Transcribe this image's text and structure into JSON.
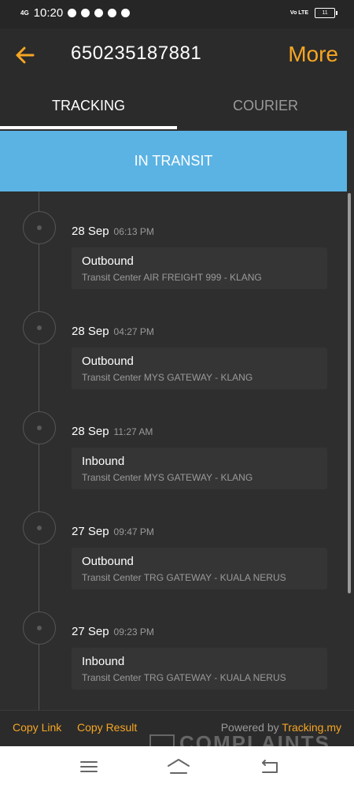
{
  "status_bar": {
    "network": "4G",
    "time": "10:20",
    "volte": "Vo LTE",
    "battery": "11"
  },
  "header": {
    "back_icon": "arrow-left-icon",
    "tracking_number": "650235187881",
    "more_label": "More",
    "accent_color": "#f6a623"
  },
  "tabs": [
    {
      "label": "TRACKING",
      "active": true
    },
    {
      "label": "COURIER",
      "active": false
    }
  ],
  "status_banner": {
    "label": "IN TRANSIT",
    "color": "#5bb3e4"
  },
  "events": [
    {
      "date": "28 Sep",
      "time": "06:13 PM",
      "type": "Outbound",
      "location": "Transit Center AIR FREIGHT 999 - KLANG"
    },
    {
      "date": "28 Sep",
      "time": "04:27 PM",
      "type": "Outbound",
      "location": "Transit Center MYS GATEWAY - KLANG"
    },
    {
      "date": "28 Sep",
      "time": "11:27 AM",
      "type": "Inbound",
      "location": "Transit Center MYS GATEWAY - KLANG"
    },
    {
      "date": "27 Sep",
      "time": "09:47 PM",
      "type": "Outbound",
      "location": "Transit Center TRG GATEWAY - KUALA NERUS"
    },
    {
      "date": "27 Sep",
      "time": "09:23 PM",
      "type": "Inbound",
      "location": "Transit Center TRG GATEWAY - KUALA NERUS"
    }
  ],
  "footer": {
    "copy_link": "Copy Link",
    "copy_result": "Copy Result",
    "powered_by": "Powered by",
    "brand": "Tracking.my",
    "watermark": "COMPLAINTS"
  },
  "nav_bar": {
    "menu_icon": "menu-icon",
    "home_icon": "home-icon",
    "back_icon": "back-icon"
  }
}
